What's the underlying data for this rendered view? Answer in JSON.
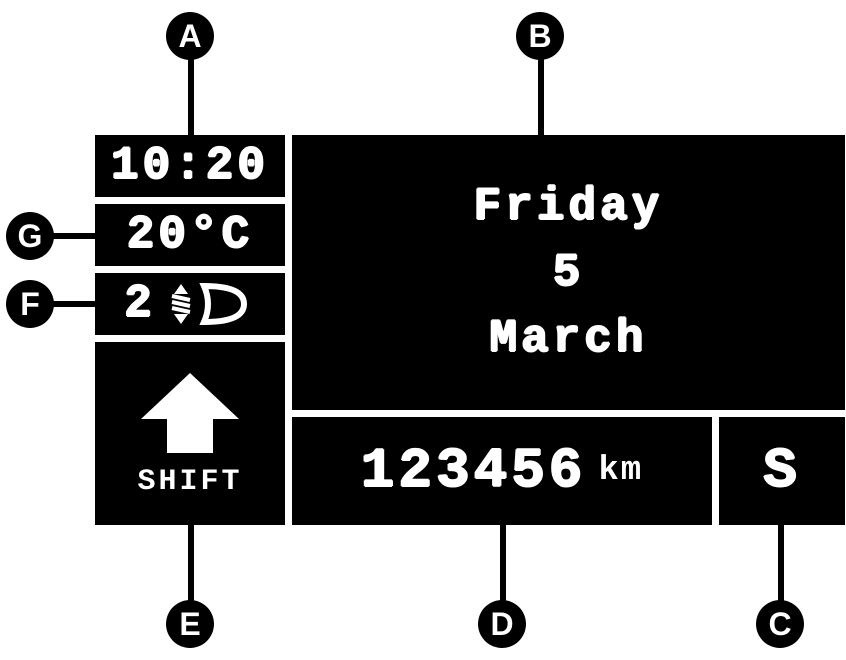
{
  "callouts": {
    "A": "A",
    "B": "B",
    "C": "C",
    "D": "D",
    "E": "E",
    "F": "F",
    "G": "G"
  },
  "clock": {
    "time": "10:20"
  },
  "temperature": {
    "value": "20°C"
  },
  "headlight": {
    "level": "2"
  },
  "shift": {
    "label": "SHIFT"
  },
  "date": {
    "weekday": "Friday",
    "day": "5",
    "month": "March"
  },
  "odometer": {
    "value": "123456",
    "unit": "km"
  },
  "mode": {
    "value": "S"
  }
}
